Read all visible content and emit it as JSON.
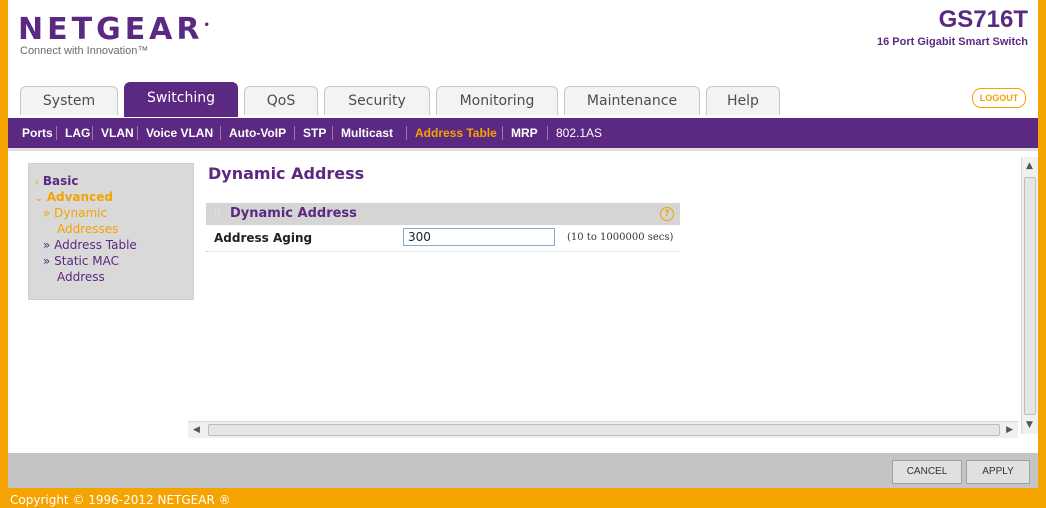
{
  "header": {
    "logo": "NETGEAR",
    "tagline": "Connect with Innovation™",
    "model": "GS716T",
    "model_desc": "16 Port Gigabit Smart Switch",
    "logout": "LOGOUT"
  },
  "tabs": [
    {
      "label": "System"
    },
    {
      "label": "Switching"
    },
    {
      "label": "QoS"
    },
    {
      "label": "Security"
    },
    {
      "label": "Monitoring"
    },
    {
      "label": "Maintenance"
    },
    {
      "label": "Help"
    }
  ],
  "subnav": [
    {
      "label": "Ports"
    },
    {
      "label": "LAG"
    },
    {
      "label": "VLAN"
    },
    {
      "label": "Voice VLAN"
    },
    {
      "label": "Auto-VoIP"
    },
    {
      "label": "STP"
    },
    {
      "label": "Multicast"
    },
    {
      "label": "Address Table"
    },
    {
      "label": "MRP"
    },
    {
      "label": "802.1AS"
    }
  ],
  "sidebar": {
    "basic": "Basic",
    "advanced": "Advanced",
    "items": [
      {
        "label": "Dynamic"
      },
      {
        "label": "Addresses"
      },
      {
        "label": "Address Table"
      },
      {
        "label": "Static MAC"
      },
      {
        "label": "Address"
      }
    ]
  },
  "main": {
    "title": "Dynamic Address",
    "panel_title": "Dynamic Address",
    "help": "?",
    "field_label": "Address Aging",
    "field_value": "300",
    "field_range": "(10 to 1000000 secs)"
  },
  "buttons": {
    "cancel": "CANCEL",
    "apply": "APPLY"
  },
  "footer": {
    "copyright": "Copyright © 1996-2012 NETGEAR ®"
  }
}
